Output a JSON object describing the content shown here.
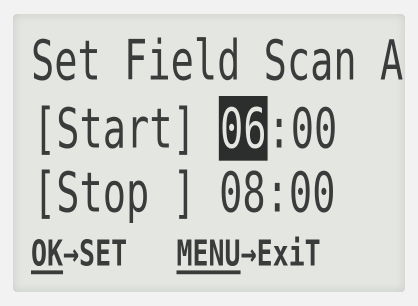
{
  "screen": {
    "title": "Set Field Scan A"
  },
  "start": {
    "label": "[Start]",
    "hour": "06",
    "separator": ":",
    "minute": "00"
  },
  "stop": {
    "label": "[Stop ]",
    "hour": "08",
    "separator": ":",
    "minute": "00"
  },
  "footer": {
    "ok_key": "OK",
    "ok_arrow": "→",
    "ok_action": "SET",
    "menu_key": "MENU",
    "menu_arrow": "→",
    "menu_action": "ExiT"
  }
}
